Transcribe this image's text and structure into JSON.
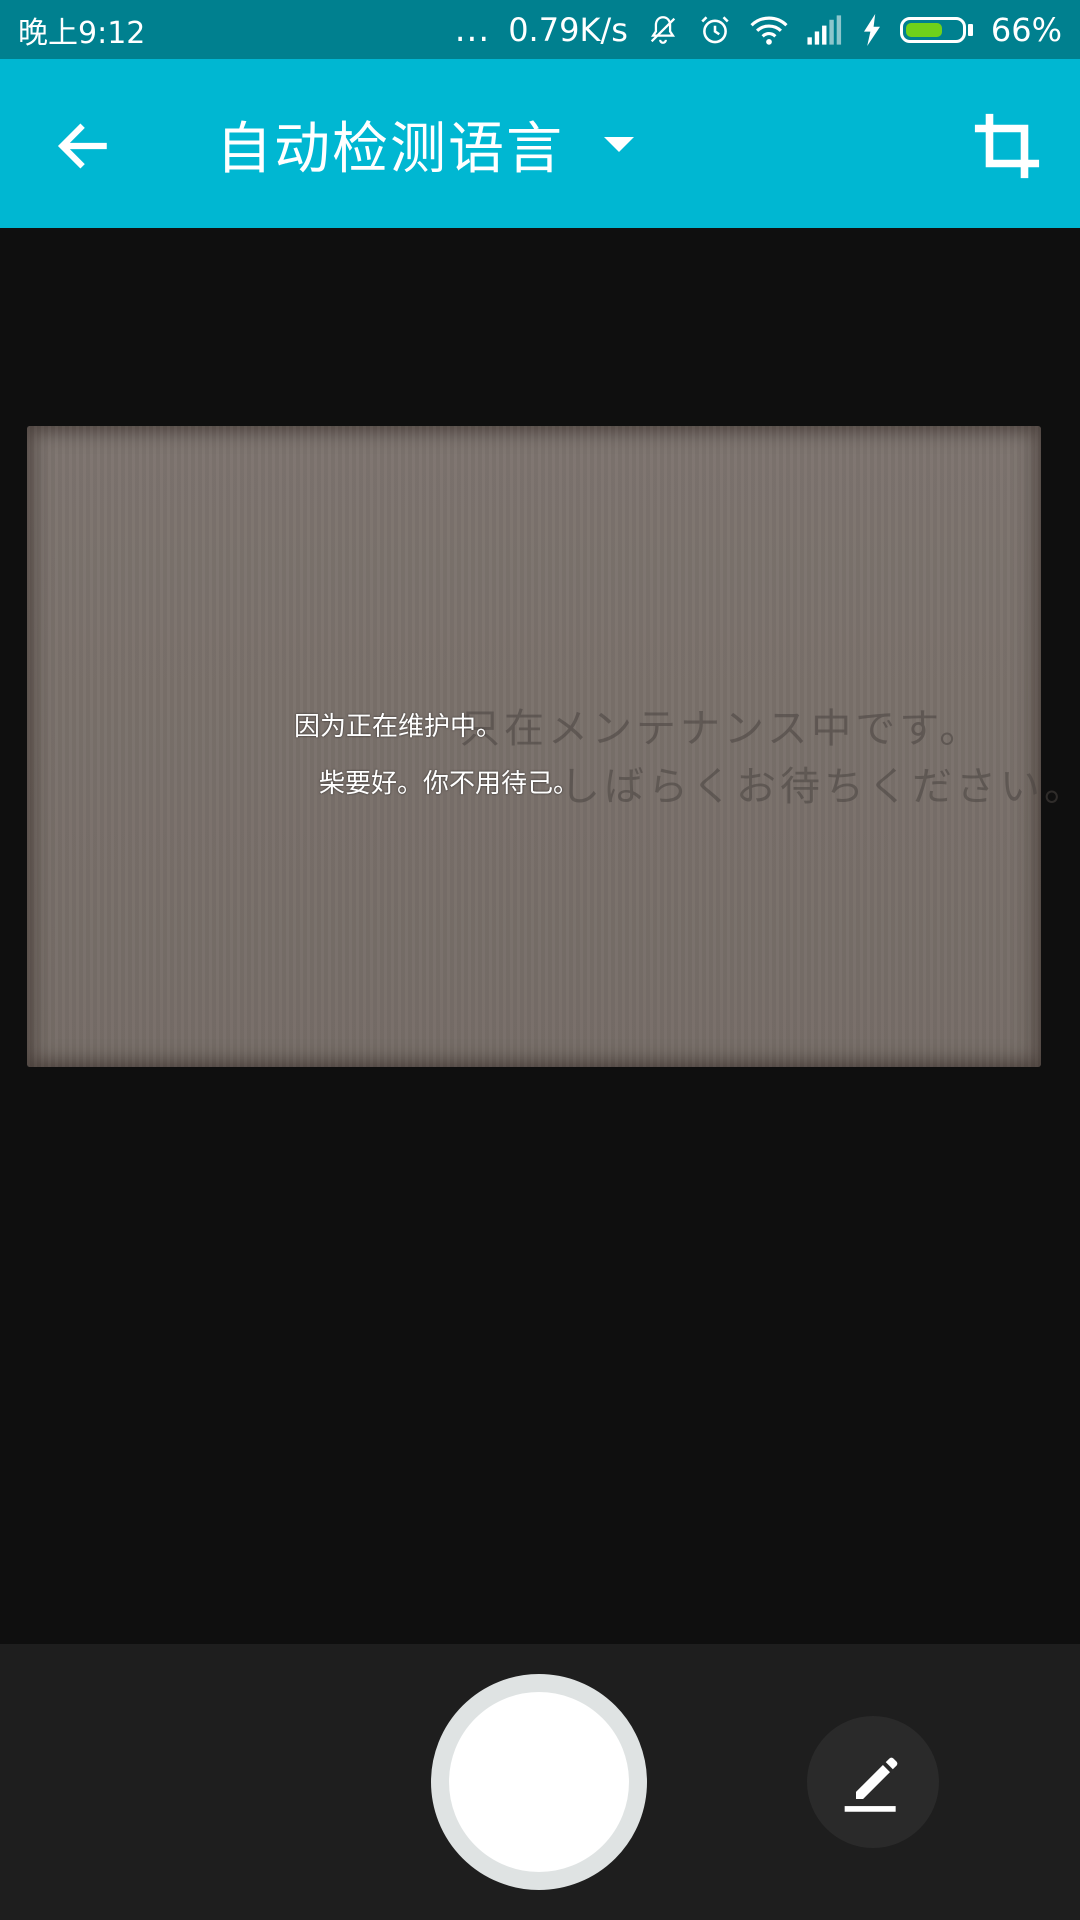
{
  "status_bar": {
    "time": "晚上9:12",
    "dots": "...",
    "net_speed": "0.79K/s",
    "battery_text": "66%",
    "battery_level": 0.66,
    "icons": [
      "notification-mute-icon",
      "alarm-icon",
      "wifi-icon",
      "signal-icon",
      "charging-icon",
      "battery-icon"
    ]
  },
  "app_bar": {
    "back_icon": "arrow-left-icon",
    "language_label": "自动检测语言",
    "dropdown_icon": "caret-down-icon",
    "crop_icon": "crop-icon",
    "background_color": "#00b7d2"
  },
  "preview": {
    "source_lines": [
      "只在メンテナンス中です。",
      "しばらくお待ちください。"
    ],
    "ocr_overlay": {
      "line1": "因为正在维护中。",
      "line2": "柴要好。你不用待己。"
    }
  },
  "bottom_bar": {
    "shutter_icon": "shutter-icon",
    "edit_icon": "pencil-icon"
  }
}
